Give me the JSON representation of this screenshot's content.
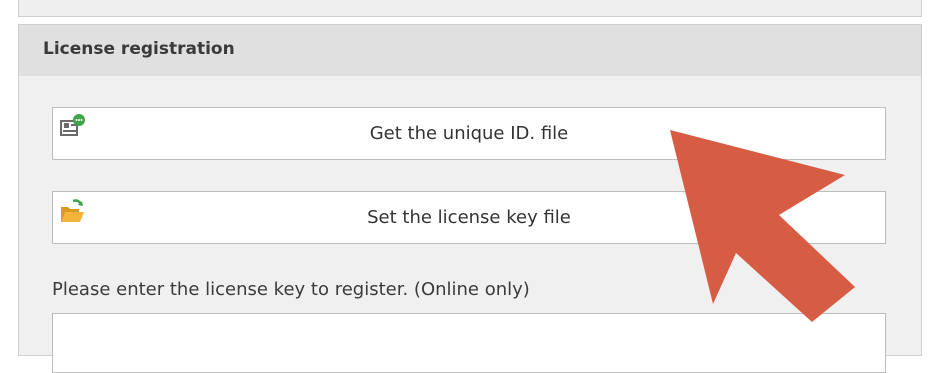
{
  "group": {
    "title": "License registration"
  },
  "buttons": {
    "get_id_label": "Get the unique ID. file",
    "set_key_label": "Set the license key file"
  },
  "key_entry": {
    "prompt": "Please enter the license key to register. (Online only)",
    "value": ""
  },
  "icons": {
    "get_id": "id-card-icon",
    "set_key": "folder-open-icon",
    "annotation": "arrow-pointer-icon"
  },
  "colors": {
    "arrow": "#d65d43",
    "folder": "#f2b33a",
    "badge_green": "#3fa54a"
  }
}
